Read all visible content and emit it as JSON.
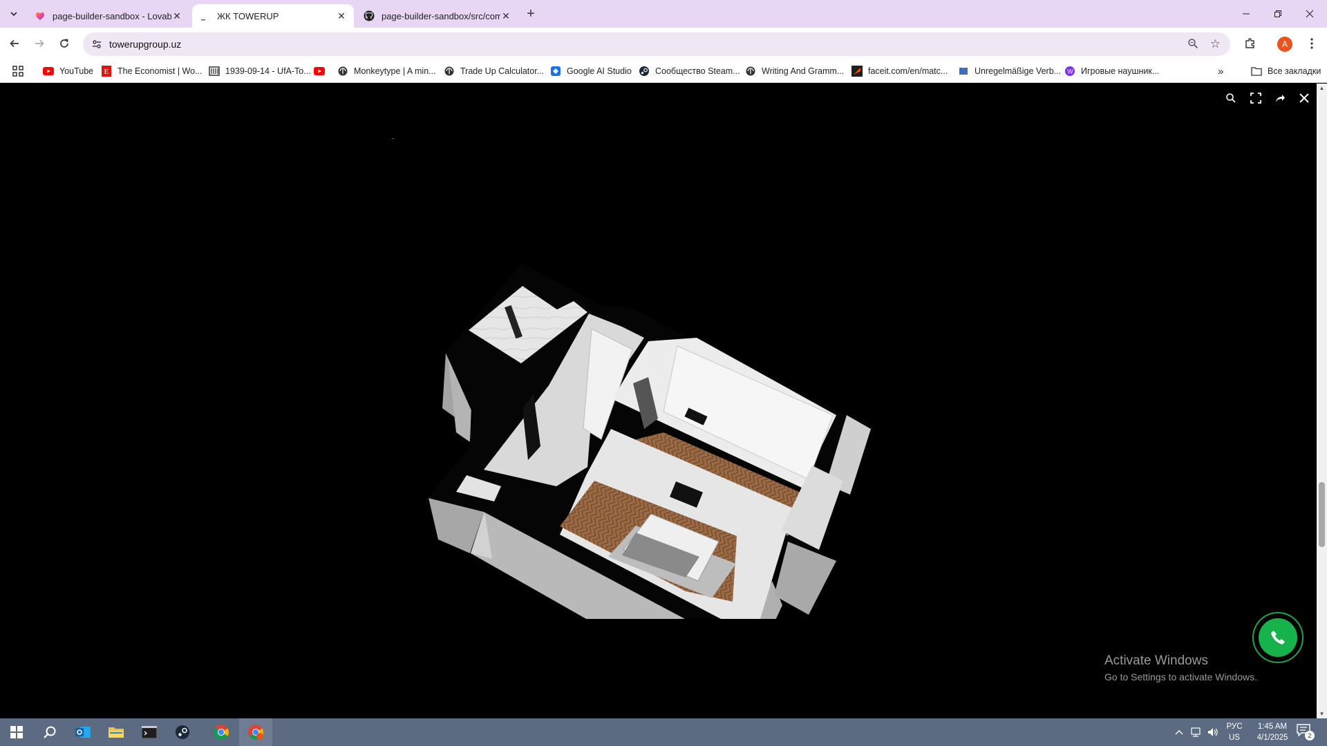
{
  "browser": {
    "tabs": [
      {
        "title": "page-builder-sandbox - Lovable",
        "favicon": "heart-icon",
        "active": false
      },
      {
        "title": "ЖК TOWERUP",
        "favicon": "loading-icon",
        "active": true
      },
      {
        "title": "page-builder-sandbox/src/components",
        "favicon": "github-icon",
        "active": false
      }
    ],
    "url": "towerupgroup.uz",
    "profile_initial": "A",
    "bookmarks": [
      {
        "label": "YouTube",
        "icon": "youtube-icon"
      },
      {
        "label": "The Economist | Wo...",
        "icon": "economist-icon"
      },
      {
        "label": "1939-09-14 - UfA-To...",
        "icon": "archive-icon"
      },
      {
        "label": "",
        "icon": "youtube-icon"
      },
      {
        "label": "Monkeytype | A min...",
        "icon": "globe-icon"
      },
      {
        "label": "Trade Up Calculator...",
        "icon": "globe-icon"
      },
      {
        "label": "Google AI Studio",
        "icon": "ai-studio-icon"
      },
      {
        "label": "Сообщество Steam...",
        "icon": "steam-icon"
      },
      {
        "label": "Writing And Gramm...",
        "icon": "globe-icon"
      },
      {
        "label": "faceit.com/en/matc...",
        "icon": "faceit-icon"
      },
      {
        "label": "Unregelmäßige Verb...",
        "icon": "book-icon"
      },
      {
        "label": "Игровые наушник...",
        "icon": "shop-icon"
      }
    ],
    "all_bookmarks_label": "Все закладки"
  },
  "viewer": {
    "controls": [
      "zoom-icon",
      "fullscreen-icon",
      "share-icon",
      "close-icon"
    ]
  },
  "watermark": {
    "heading": "Activate Windows",
    "subtext": "Go to Settings to activate Windows."
  },
  "colors": {
    "tabbar": "#e8d6f5",
    "call_button": "#17b24b",
    "taskbar": "#5c6a82",
    "floor_wood": "#9a6a45"
  },
  "taskbar": {
    "apps": [
      "windows-start-icon",
      "search-icon",
      "outlook-icon",
      "file-explorer-icon",
      "terminal-icon",
      "steam-icon",
      "chrome-icon",
      "chrome-profile-icon"
    ],
    "lang_line1": "РУС",
    "lang_line2": "US",
    "time": "1:45 AM",
    "date": "4/1/2025",
    "notifications": "2"
  }
}
